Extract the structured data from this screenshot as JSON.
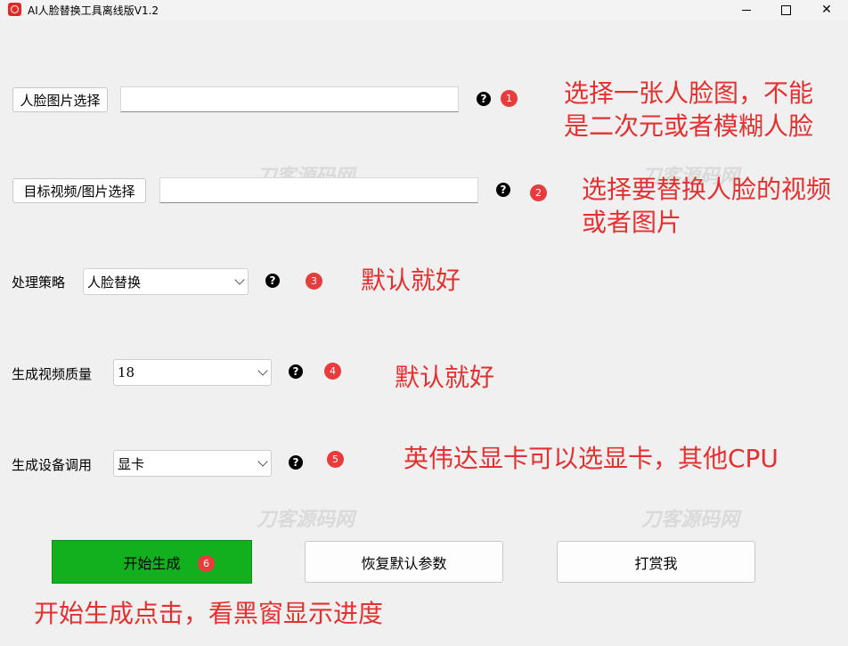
{
  "window": {
    "title": "AI人脸替换工具离线版V1.2",
    "controls": {
      "minimize": "—",
      "maximize": "□",
      "close": "✕"
    }
  },
  "face_select": {
    "button_label": "人脸图片选择",
    "value": "",
    "help": "?",
    "badge": "1",
    "note": "选择一张人脸图，不能\n是二次元或者模糊人脸"
  },
  "target_select": {
    "button_label": "目标视频/图片选择",
    "value": "",
    "help": "?",
    "badge": "2",
    "note": "选择要替换人脸的视频\n或者图片"
  },
  "strategy": {
    "label": "处理策略",
    "selected": "人脸替换",
    "help": "?",
    "badge": "3",
    "note": "默认就好"
  },
  "quality": {
    "label": "生成视频质量",
    "selected": "18",
    "help": "?",
    "badge": "4",
    "note": "默认就好"
  },
  "device": {
    "label": "生成设备调用",
    "selected": "显卡",
    "help": "?",
    "badge": "5",
    "note": "英伟达显卡可以选显卡，其他CPU"
  },
  "actions": {
    "start_label": "开始生成",
    "start_badge": "6",
    "reset_label": "恢复默认参数",
    "tip_label": "打赏我",
    "note": "开始生成点击，看黑窗显示进度"
  },
  "watermarks": [
    "刀客源码网",
    "刀客源码网",
    "刀客源码网",
    "刀客源码网"
  ],
  "colors": {
    "accent_green": "#12b01f",
    "annotation_red": "#e53030",
    "badge_red": "#e83b3b"
  }
}
